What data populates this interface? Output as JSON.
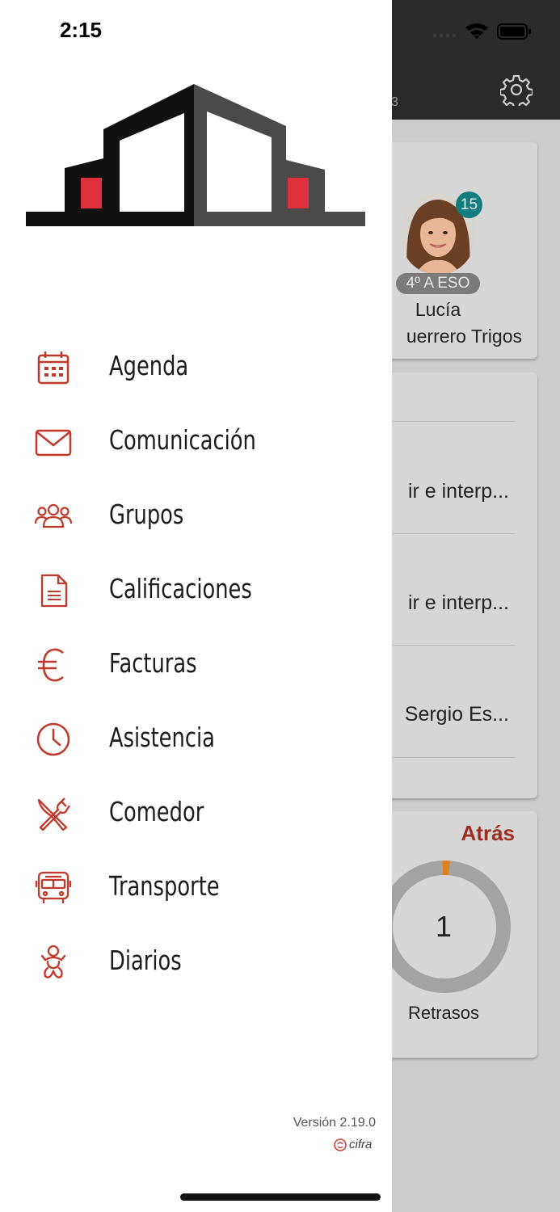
{
  "status_bar": {
    "time": "2:15"
  },
  "background": {
    "header_subtitle_fragment": "3",
    "student": {
      "badge_count": "15",
      "grade": "4º A ESO",
      "first_name": "Lucía",
      "last_name_fragment": "uerrero Trigos"
    },
    "list_items": [
      "ir e interp...",
      "ir e interp...",
      "Sergio Es..."
    ],
    "stats": {
      "back_label": "Atrás",
      "value": "1",
      "label": "Retrasos"
    },
    "colors": {
      "accent": "#9e2c20",
      "badge": "#137c7c",
      "donut_marker": "#e0801f"
    }
  },
  "drawer": {
    "menu": [
      {
        "label": "Agenda",
        "icon": "calendar-icon"
      },
      {
        "label": "Comunicación",
        "icon": "mail-icon"
      },
      {
        "label": "Grupos",
        "icon": "users-icon"
      },
      {
        "label": "Calificaciones",
        "icon": "document-icon"
      },
      {
        "label": "Facturas",
        "icon": "euro-icon"
      },
      {
        "label": "Asistencia",
        "icon": "clock-icon"
      },
      {
        "label": "Comedor",
        "icon": "utensils-icon"
      },
      {
        "label": "Transporte",
        "icon": "bus-icon"
      },
      {
        "label": "Diarios",
        "icon": "baby-icon"
      }
    ],
    "version": "Versión 2.19.0",
    "brand": "cifra",
    "icon_color": "#c0392b"
  }
}
